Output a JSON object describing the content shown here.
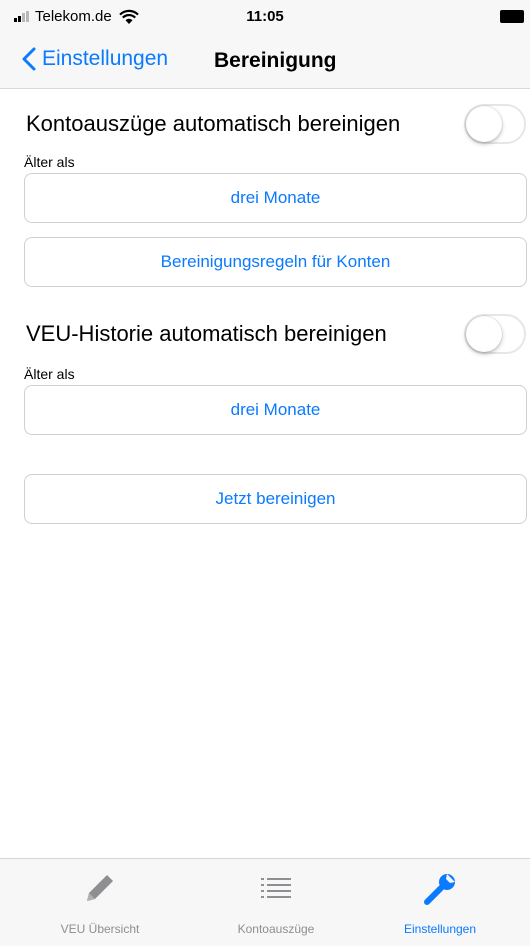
{
  "status_bar": {
    "carrier": "Telekom.de",
    "time": "11:05"
  },
  "nav": {
    "back_label": "Einstellungen",
    "title": "Bereinigung"
  },
  "settings": {
    "account_statements": {
      "label": "Kontoauszüge automatisch bereinigen",
      "enabled": false,
      "older_than_label": "Älter als",
      "older_than_value": "drei Monate"
    },
    "rules_button": "Bereinigungsregeln für Konten",
    "veu_history": {
      "label": "VEU-Historie automatisch bereinigen",
      "enabled": false,
      "older_than_label": "Älter als",
      "older_than_value": "drei Monate"
    },
    "clean_now_button": "Jetzt bereinigen"
  },
  "tabs": [
    {
      "label": "VEU Übersicht",
      "icon": "pencil-icon",
      "active": false
    },
    {
      "label": "Kontoauszüge",
      "icon": "list-icon",
      "active": false
    },
    {
      "label": "Einstellungen",
      "icon": "wrench-icon",
      "active": true
    }
  ],
  "colors": {
    "accent": "#0a7aff",
    "inactive": "#8e8e93",
    "bar_background": "#f7f7f7"
  }
}
